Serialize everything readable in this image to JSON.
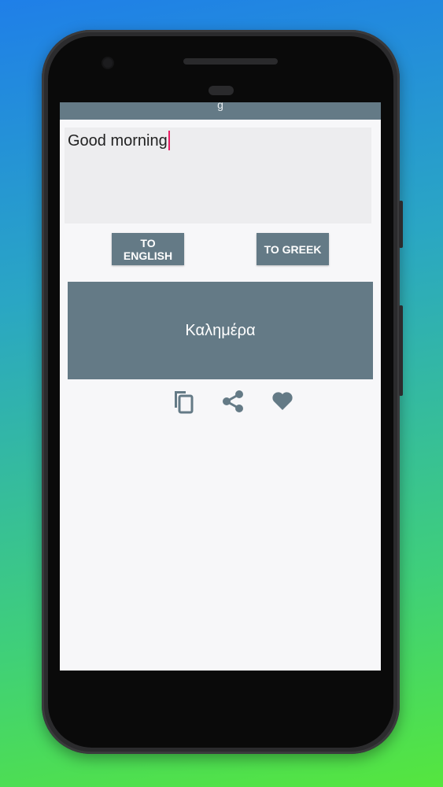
{
  "app": {
    "title_partial": "g"
  },
  "input": {
    "value": "Good morning"
  },
  "buttons": {
    "to_english": "TO ENGLISH",
    "to_greek": "TO GREEK"
  },
  "output": {
    "text": "Καλημέρα"
  },
  "actions": {
    "copy_icon": "copy-icon",
    "share_icon": "share-icon",
    "favorite_icon": "heart-icon"
  },
  "colors": {
    "accent": "#647a86",
    "caret": "#e91e63"
  }
}
